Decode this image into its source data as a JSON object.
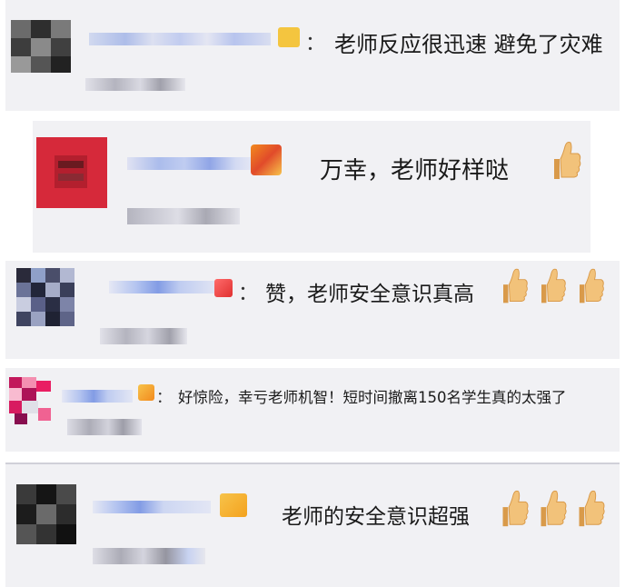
{
  "comments": [
    {
      "text": "老师反应很迅速 避免了灾难",
      "thumbs": 0
    },
    {
      "text": "万幸，老师好样哒",
      "thumbs": 1
    },
    {
      "text": "赞，老师安全意识真高",
      "thumbs": 3
    },
    {
      "text": "好惊险，幸亏老师机智！短时间撤离150名学生真的太强了",
      "thumbs": 0
    },
    {
      "text": "老师的安全意识超强",
      "thumbs": 3
    }
  ],
  "colon": "：",
  "icons": {
    "like": "thumbs-up-icon",
    "badge": "user-badge-icon"
  },
  "colors": {
    "card_bg": "#f1f1f4",
    "thumb": "#f2c27a",
    "thumb_shade": "#d99a4a",
    "avatar_red": "#d6293a"
  }
}
